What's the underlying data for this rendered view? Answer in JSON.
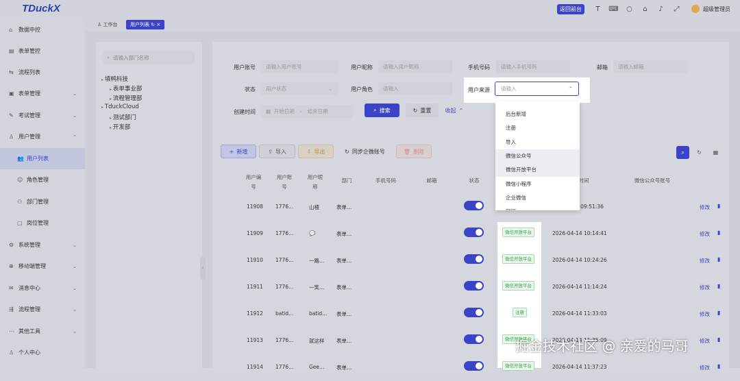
{
  "app": {
    "logo": "TDuckX",
    "back_label": "返回前台",
    "user_name": "超级管理员"
  },
  "tabs": [
    {
      "label": "工作台"
    },
    {
      "label": "用户列表"
    }
  ],
  "sidebar": [
    {
      "label": "数据中控",
      "icon": "home-icon",
      "chev": false
    },
    {
      "label": "表单管控",
      "icon": "form-icon",
      "chev": false
    },
    {
      "label": "流程列表",
      "icon": "flow-icon",
      "chev": false
    },
    {
      "label": "表单管理",
      "icon": "form-manage-icon",
      "chev": true
    },
    {
      "label": "考试管理",
      "icon": "exam-icon",
      "chev": true
    },
    {
      "label": "用户管理",
      "icon": "user-icon",
      "chev": true
    },
    {
      "label": "用户列表",
      "icon": "users-icon",
      "chev": false,
      "sub": true,
      "active": true
    },
    {
      "label": "角色管理",
      "icon": "role-icon",
      "chev": false,
      "sub": true
    },
    {
      "label": "部门管理",
      "icon": "dept-icon",
      "chev": false,
      "sub": true
    },
    {
      "label": "岗位管理",
      "icon": "post-icon",
      "chev": false,
      "sub": true
    },
    {
      "label": "系统管理",
      "icon": "gear-icon",
      "chev": true
    },
    {
      "label": "移动端管理",
      "icon": "mobile-icon",
      "chev": true
    },
    {
      "label": "消息中心",
      "icon": "message-icon",
      "chev": true
    },
    {
      "label": "流程管理",
      "icon": "process-icon",
      "chev": true
    },
    {
      "label": "其他工具",
      "icon": "tool-icon",
      "chev": true
    },
    {
      "label": "个人中心",
      "icon": "person-icon",
      "chev": false
    }
  ],
  "tree": {
    "search_placeholder": "请输入部门名称",
    "nodes": [
      {
        "label": "填鸭科技",
        "level": 0
      },
      {
        "label": "表单事业部",
        "level": 1
      },
      {
        "label": "流程管理部",
        "level": 1
      },
      {
        "label": "TduckCloud",
        "level": 0
      },
      {
        "label": "测试部门",
        "level": 1
      },
      {
        "label": "开发部",
        "level": 1
      }
    ]
  },
  "filters": {
    "account_label": "用户账号",
    "account_placeholder": "请输入用户账号",
    "nickname_label": "用户昵称",
    "nickname_placeholder": "请输入用户昵称",
    "phone_label": "手机号码",
    "phone_placeholder": "请输入手机号码",
    "email_label": "邮箱",
    "email_placeholder": "请输入邮箱",
    "status_label": "状态",
    "status_placeholder": "用户状态",
    "role_label": "用户角色",
    "role_placeholder": "请输入",
    "source_label": "用户来源",
    "source_placeholder": "请输入",
    "time_label": "创建时间",
    "start_placeholder": "开始日期",
    "end_placeholder": "结束日期",
    "date_sep": "-",
    "search_label": "搜索",
    "reset_label": "重置",
    "collapse_label": "收起"
  },
  "source_options": [
    "后台新增",
    "注册",
    "导入",
    "微信公众号",
    "微信开放平台",
    "微信小程序",
    "企业微信",
    "钉钉"
  ],
  "toolbar": {
    "add": "新增",
    "import": "导入",
    "export": "导出",
    "sync": "同步企微账号",
    "delete": "删除"
  },
  "table": {
    "headers": [
      "用户编\n号",
      "用户账\n号",
      "用户昵\n称",
      "部门",
      "手机号码",
      "邮箱",
      "状态",
      "时间",
      "微信公众号账号"
    ],
    "rows": [
      {
        "id": "11908",
        "account": "1776...",
        "nick": "山楂",
        "dept": "表单...",
        "source": "",
        "time": "5 09:51:36"
      },
      {
        "id": "11909",
        "account": "1776...",
        "nick": "💬",
        "dept": "表单...",
        "source": "微信开放平台",
        "time": "2026-04-14 10:14:41"
      },
      {
        "id": "11910",
        "account": "1776...",
        "nick": "一路...",
        "dept": "表单...",
        "source": "微信开放平台",
        "time": "2026-04-14 10:24:26"
      },
      {
        "id": "11911",
        "account": "1776...",
        "nick": "一笑...",
        "dept": "表单...",
        "source": "微信开放平台",
        "time": "2026-04-14 11:14:24"
      },
      {
        "id": "11912",
        "account": "batid...",
        "nick": "batid...",
        "dept": "表单...",
        "source": "注册",
        "time": "2026-04-14 11:33:03"
      },
      {
        "id": "11913",
        "account": "1776...",
        "nick": "就这样",
        "dept": "表单...",
        "source": "微信开放平台",
        "time": "2026-04-14 11:35:09"
      },
      {
        "id": "11914",
        "account": "1776...",
        "nick": "Gee...",
        "dept": "表单...",
        "source": "微信开放平台",
        "time": "2026-04-14 11:37:23"
      }
    ],
    "edit_label": "修改"
  },
  "watermark": "掘金技术社区 @ 亲爱的马哥"
}
